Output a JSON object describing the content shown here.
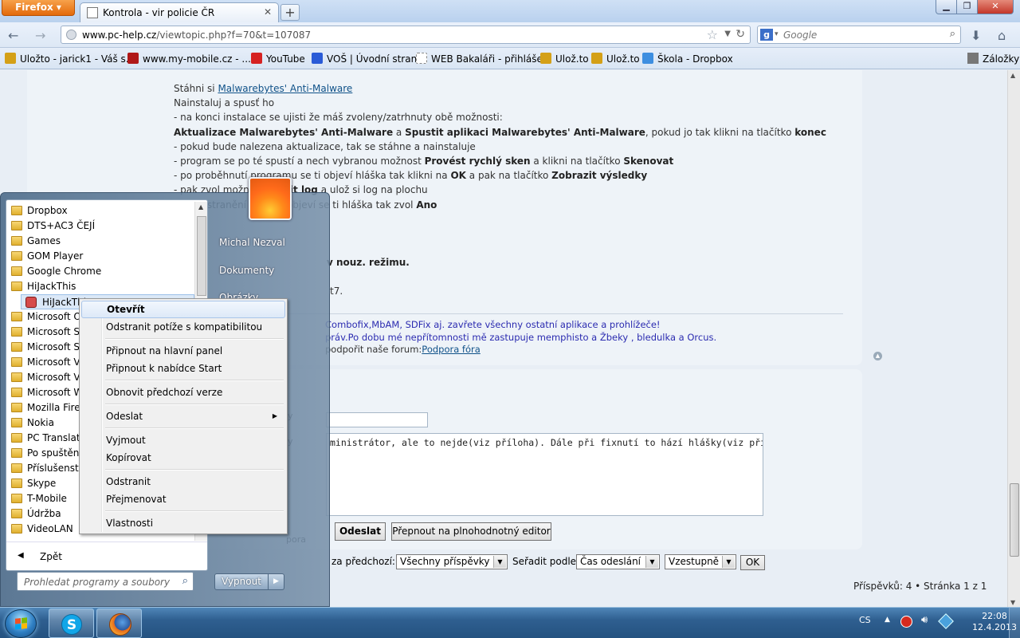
{
  "browser": {
    "menu_button": "Firefox",
    "tab_title": "Kontrola - vir policie ČR",
    "url_domain": "www.pc-help.cz",
    "url_path": "/viewtopic.php?f=70&t=107087",
    "search_engine_letter": "g",
    "search_placeholder": "Google",
    "bookmarks_menu_label": "Záložky",
    "bookmarks": [
      {
        "label": "Uložto - jarick1 - Váš s...",
        "color": "#d4a017"
      },
      {
        "label": "www.my-mobile.cz - ...",
        "color": "#b01818"
      },
      {
        "label": "YouTube",
        "color": "#d62222"
      },
      {
        "label": "VOŠ | Úvodní strana",
        "color": "#2a5bd7"
      },
      {
        "label": "WEB Bakaláři - přihláše...",
        "color": "#ffffff"
      },
      {
        "label": "Ulož.to",
        "color": "#d4a017"
      },
      {
        "label": "Ulož.to",
        "color": "#d4a017"
      },
      {
        "label": "Škola - Dropbox",
        "color": "#3d8ee0"
      }
    ]
  },
  "post": {
    "lines": [
      {
        "pre": "Stáhni si ",
        "link": "Malwarebytes' Anti-Malware",
        "post": ""
      },
      {
        "pre": "Nainstaluj a spusť ho",
        "link": "",
        "post": ""
      },
      {
        "pre": "- na konci instalace se ujisti že máš zvoleny/zatrhnuty obě možnosti:",
        "link": "",
        "post": ""
      },
      {
        "bold1": "Aktualizace Malwarebytes' Anti-Malware",
        "mid": " a ",
        "bold2": "Spustit aplikaci Malwarebytes' Anti-Malware",
        "rest": ", pokud jo tak klikni na tlačítko ",
        "bold3": "konec"
      },
      {
        "pre": "- pokud bude nalezena aktualizace, tak se stáhne a nainstaluje",
        "link": "",
        "post": ""
      },
      {
        "pre": "- program se po té spustí a nech vybranou možnost ",
        "b": "Provést rychlý sken",
        "mid": " a klikni na tlačítko ",
        "b2": "Skenovat"
      },
      {
        "pre": "- po proběhnutí programu se ti objeví hláška tak klikni na ",
        "b": "OK",
        "mid": " a pak na tlačítko ",
        "b2": "Zobrazit výsledky"
      },
      {
        "pre": "- pak zvol možnost ",
        "b": "Uložit log",
        "mid": " a ulož si log na plochu",
        "b2": ""
      },
      {
        "pre": "- po odstranění infekcí, objeví se ti hláška tak zvol ",
        "b": "Ano",
        "mid": "",
        "b2": ""
      }
    ],
    "partial_line_1": "v nouz. režimu.",
    "partial_line_2": "t7."
  },
  "signature": {
    "line1": "Combofix,MbAM, SDFix aj. zavřete všechny ostatní aplikace a prohlížeče!",
    "line2": "práv.Po dobu mé nepřítomnosti mě zastupuje memphisto a Žbeky , bledulka a Orcus.",
    "line3_pre": "podpořit naše forum:",
    "line3_link": "Podpora fóra"
  },
  "reply": {
    "message_text": "ministrátor, ale to nejde(viz příloha). Dále při fixnutí to hází hlášky(viz příloha).",
    "label_subject_tail": "y",
    "label_message_tail": "y",
    "label_help_tail": "pora",
    "send_button": "Odeslat",
    "full_editor_button": "Přepnout na plnohodnotný editor"
  },
  "filter": {
    "prev_label": "za předchozí:",
    "prev_value": "Všechny příspěvky",
    "sort_label": "Seřadit podle",
    "sort_value": "Čas odeslání",
    "order_value": "Vzestupně",
    "ok_button": "OK"
  },
  "pagination": "Příspěvků: 4 • Stránka 1 z 1",
  "start_menu": {
    "programs": [
      {
        "label": "Dropbox",
        "type": "folder"
      },
      {
        "label": "DTS+AC3 ČEJÍ",
        "type": "folder"
      },
      {
        "label": "Games",
        "type": "folder"
      },
      {
        "label": "GOM Player",
        "type": "folder"
      },
      {
        "label": "Google Chrome",
        "type": "folder"
      },
      {
        "label": "HiJackThis",
        "type": "folder"
      },
      {
        "label": "HiJackThis",
        "type": "app"
      },
      {
        "label": "Microsoft Of",
        "type": "folder"
      },
      {
        "label": "Microsoft Sil",
        "type": "folder"
      },
      {
        "label": "Microsoft SQ",
        "type": "folder"
      },
      {
        "label": "Microsoft Vi",
        "type": "folder"
      },
      {
        "label": "Microsoft Vi",
        "type": "folder"
      },
      {
        "label": "Microsoft W",
        "type": "folder"
      },
      {
        "label": "Mozilla Firef",
        "type": "folder"
      },
      {
        "label": "Nokia",
        "type": "folder"
      },
      {
        "label": "PC Translato",
        "type": "folder"
      },
      {
        "label": "Po spuštění",
        "type": "folder"
      },
      {
        "label": "Příslušenství",
        "type": "folder"
      },
      {
        "label": "Skype",
        "type": "folder"
      },
      {
        "label": "T-Mobile",
        "type": "folder"
      },
      {
        "label": "Údržba",
        "type": "folder"
      },
      {
        "label": "VideoLAN",
        "type": "folder"
      }
    ],
    "back_label": "Zpět",
    "search_placeholder": "Prohledat programy a soubory",
    "user_name": "Michal Nezval",
    "right_links": [
      "Dokumenty",
      "Obrázky"
    ],
    "shutdown_label": "Vypnout"
  },
  "context_menu": [
    {
      "label": "Otevřít",
      "bold": true
    },
    {
      "label": "Odstranit potíže s kompatibilitou"
    },
    {
      "sep": true
    },
    {
      "label": "Připnout na hlavní panel"
    },
    {
      "label": "Připnout k nabídce Start"
    },
    {
      "sep": true
    },
    {
      "label": "Obnovit předchozí verze"
    },
    {
      "sep": true
    },
    {
      "label": "Odeslat",
      "submenu": true
    },
    {
      "sep": true
    },
    {
      "label": "Vyjmout"
    },
    {
      "label": "Kopírovat"
    },
    {
      "sep": true
    },
    {
      "label": "Odstranit"
    },
    {
      "label": "Přejmenovat"
    },
    {
      "sep": true
    },
    {
      "label": "Vlastnosti"
    }
  ],
  "taskbar": {
    "skype_letter": "S",
    "tray_lang": "CS",
    "time": "22:08",
    "date": "12.4.2013"
  }
}
